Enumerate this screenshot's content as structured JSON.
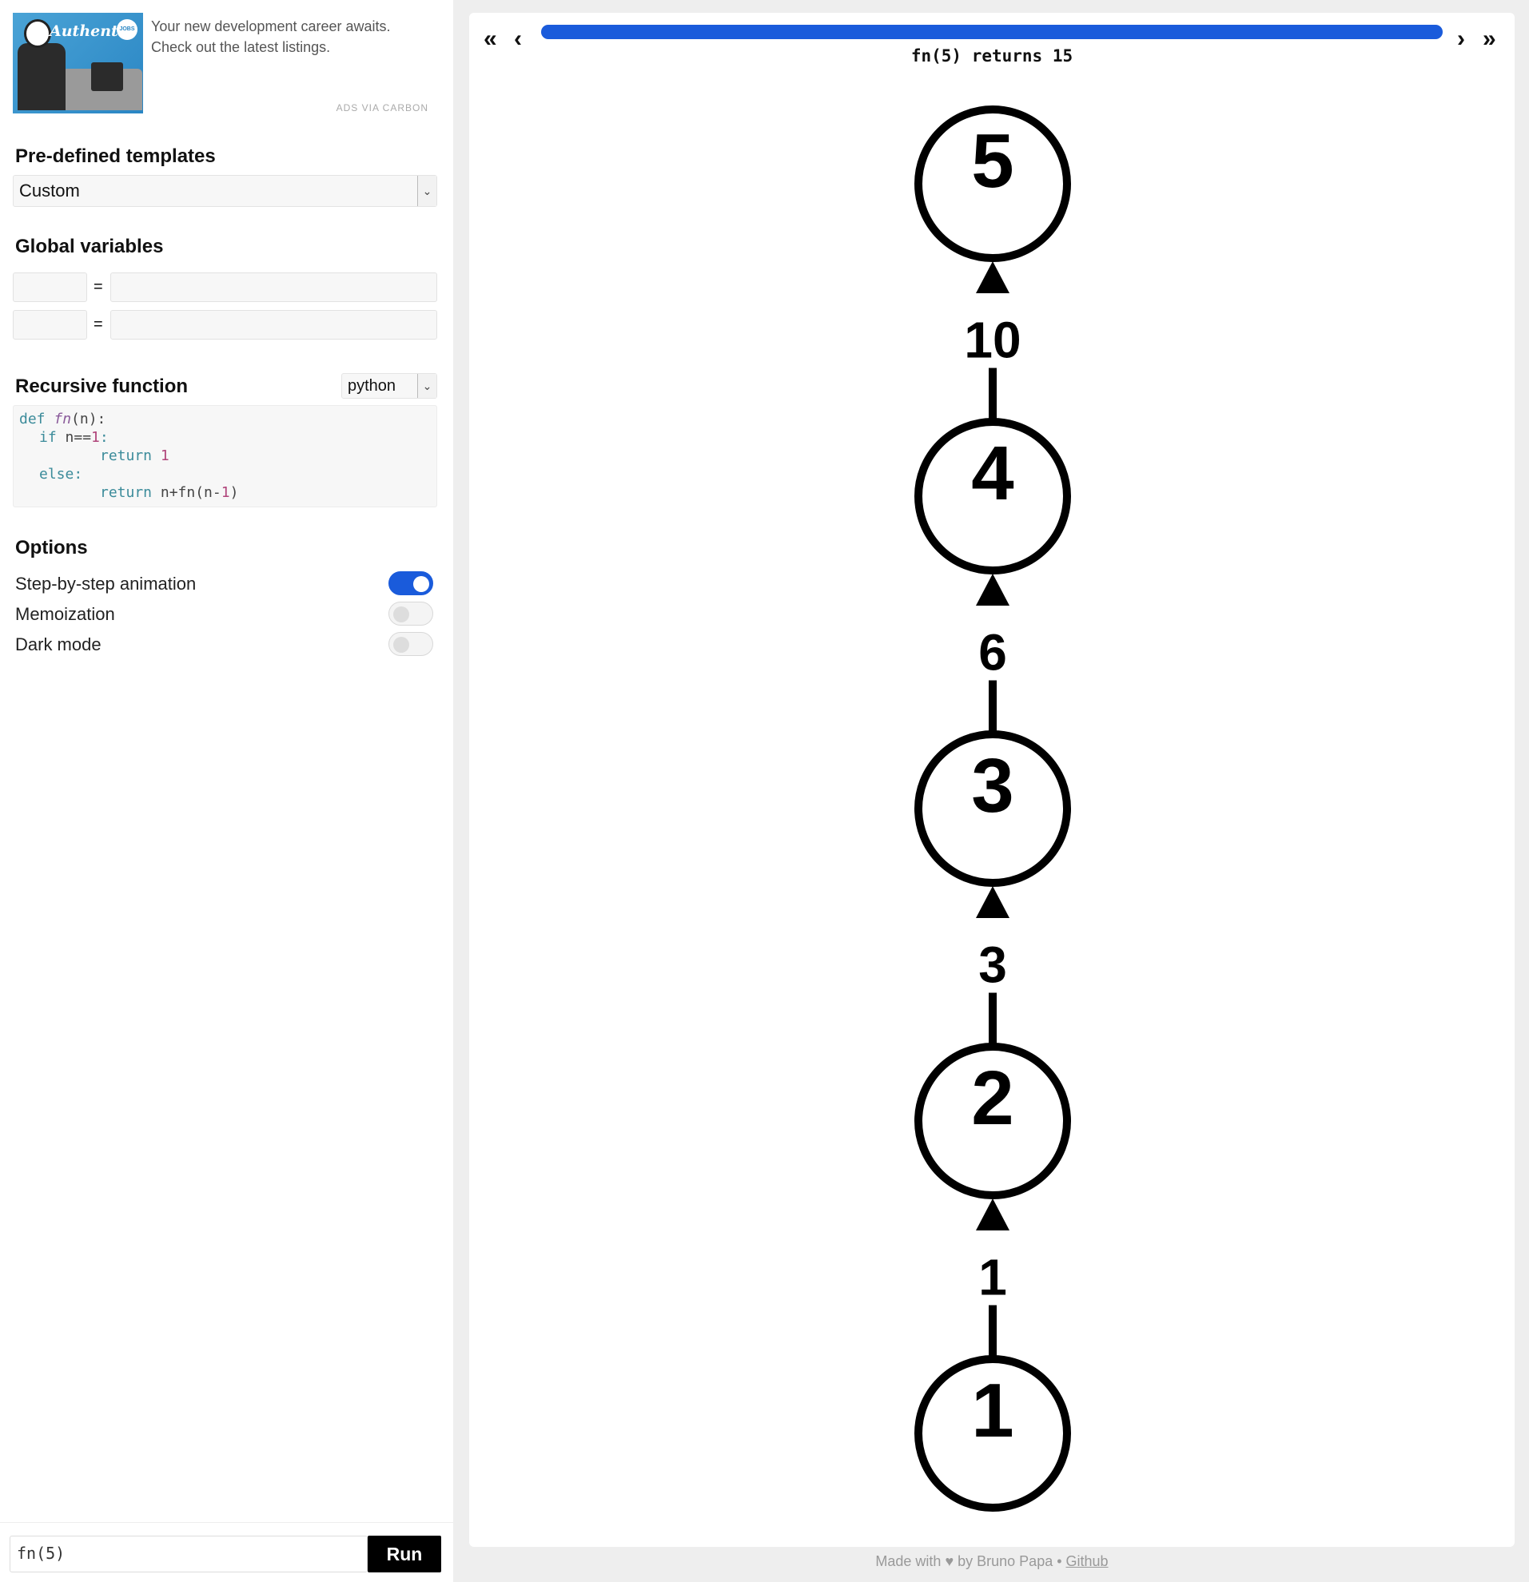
{
  "ad": {
    "brand": "Authentic",
    "badge": "JOBS",
    "text": "Your new development career awaits. Check out the latest listings.",
    "via": "ADS VIA CARBON"
  },
  "templates": {
    "title": "Pre-defined templates",
    "selected": "Custom"
  },
  "globals": {
    "title": "Global variables",
    "eq": "="
  },
  "function": {
    "title": "Recursive function",
    "language": "python",
    "code": {
      "l1_def": "def",
      "l1_name": "fn",
      "l1_rest": "(n):",
      "l2_kw": "if",
      "l2_cond": " n==",
      "l2_num": "1",
      "l2_colon": ":",
      "l3_kw": "return",
      "l3_num": "1",
      "l4_kw": "else:",
      "l5_kw": "return",
      "l5_expr": "n+fn(n-",
      "l5_num": "1",
      "l5_end": ")"
    }
  },
  "options": {
    "title": "Options",
    "items": [
      {
        "label": "Step-by-step animation",
        "on": true
      },
      {
        "label": "Memoization",
        "on": false
      },
      {
        "label": "Dark mode",
        "on": false
      }
    ]
  },
  "call": {
    "value": "fn(5)",
    "run_label": "Run"
  },
  "player": {
    "first_icon": "double-chevron-left-icon",
    "prev_icon": "chevron-left-icon",
    "next_icon": "chevron-right-icon",
    "last_icon": "double-chevron-right-icon",
    "progress": 1.0,
    "status": "fn(5) returns 15",
    "accent": "#1a5bdb"
  },
  "tree": {
    "nodes": [
      "5",
      "4",
      "3",
      "2",
      "1"
    ],
    "edges": [
      "10",
      "6",
      "3",
      "1"
    ]
  },
  "footer": {
    "prefix": "Made with ♥ by Bruno Papa • ",
    "link": "Github"
  }
}
